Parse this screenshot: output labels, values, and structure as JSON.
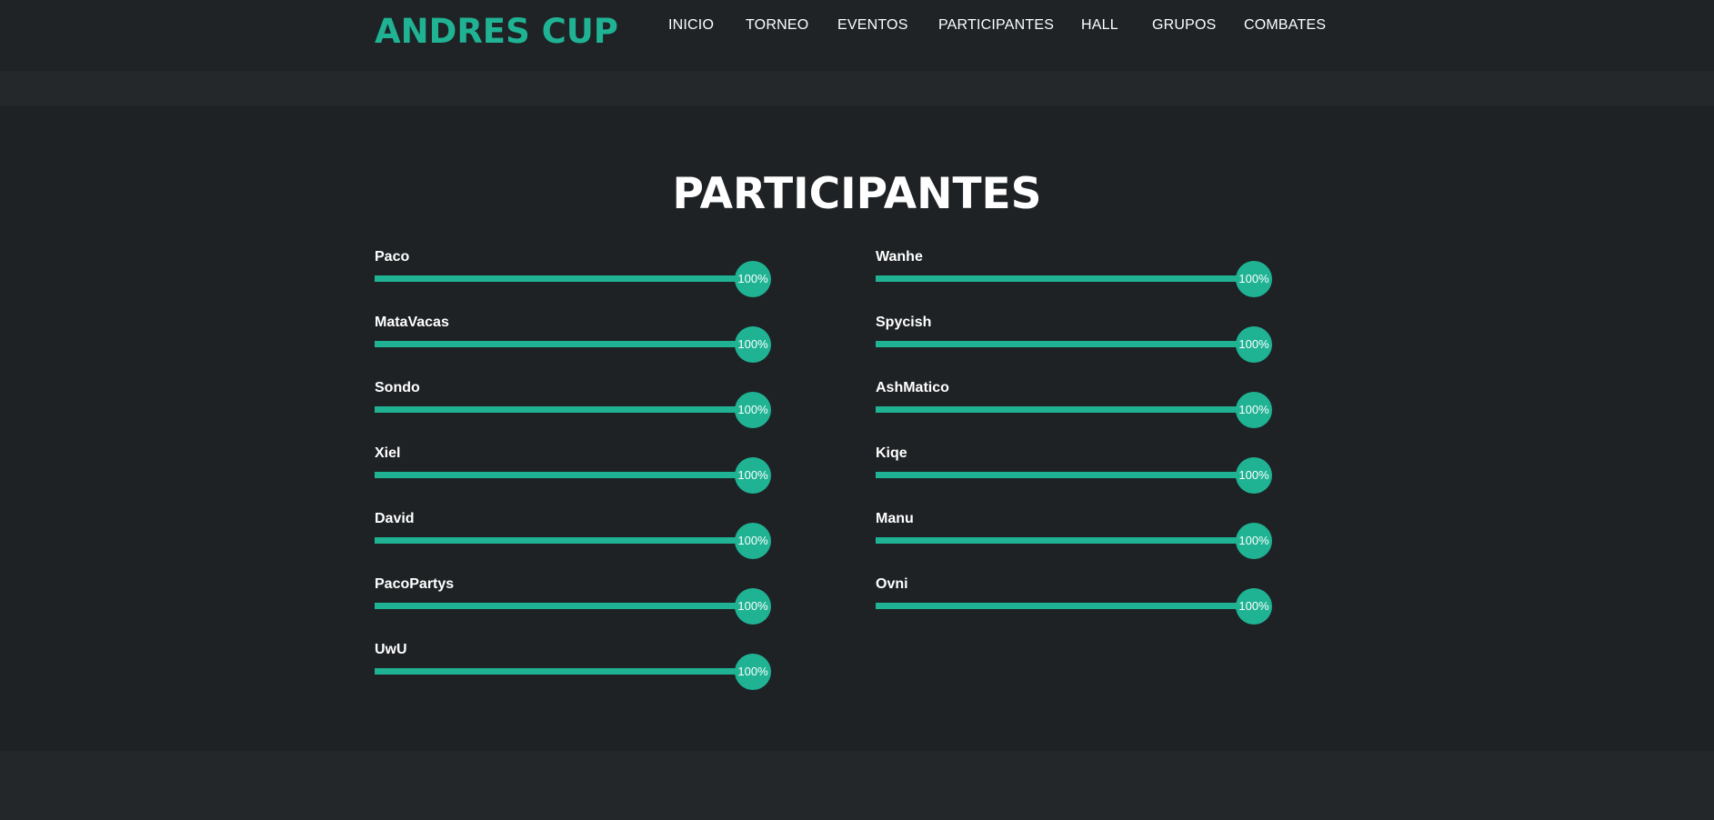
{
  "header": {
    "logo": "ANDRES CUP",
    "nav": [
      "INICIO",
      "TORNEO",
      "EVENTOS",
      "PARTICIPANTES",
      "HALL",
      "GRUPOS",
      "COMBATES"
    ]
  },
  "section": {
    "title": "PARTICIPANTES"
  },
  "participants_left": [
    {
      "name": "Paco",
      "percent_label": "100%",
      "value": 100
    },
    {
      "name": "MataVacas",
      "percent_label": "100%",
      "value": 100
    },
    {
      "name": "Sondo",
      "percent_label": "100%",
      "value": 100
    },
    {
      "name": "Xiel",
      "percent_label": "100%",
      "value": 100
    },
    {
      "name": "David",
      "percent_label": "100%",
      "value": 100
    },
    {
      "name": "PacoPartys",
      "percent_label": "100%",
      "value": 100
    },
    {
      "name": "UwU",
      "percent_label": "100%",
      "value": 100
    }
  ],
  "participants_right": [
    {
      "name": "Wanhe",
      "percent_label": "100%",
      "value": 100
    },
    {
      "name": "Spycish",
      "percent_label": "100%",
      "value": 100
    },
    {
      "name": "AshMatico",
      "percent_label": "100%",
      "value": 100
    },
    {
      "name": "Kiqe",
      "percent_label": "100%",
      "value": 100
    },
    {
      "name": "Manu",
      "percent_label": "100%",
      "value": 100
    },
    {
      "name": "Ovni",
      "percent_label": "100%",
      "value": 100
    }
  ],
  "colors": {
    "accent": "#1fb394",
    "header_bg": "#1f2326",
    "main_bg": "#1e2225",
    "text": "#ffffff"
  }
}
